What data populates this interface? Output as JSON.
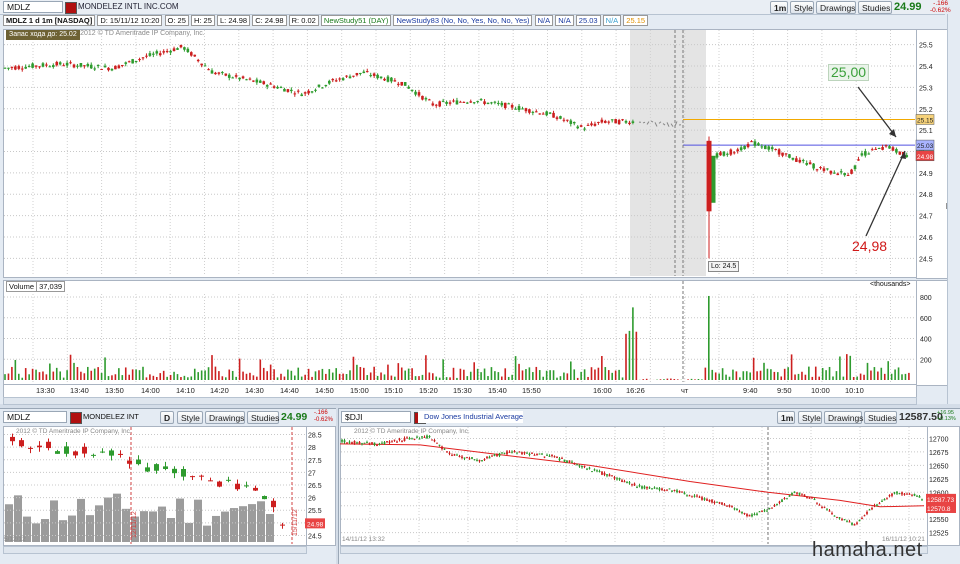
{
  "main": {
    "symbol": "MDLZ",
    "company": "MONDELEZ INTL INC.COM",
    "toolbar": {
      "style": "Style",
      "drawings": "Drawings",
      "studies": "Studies",
      "period": "1m"
    },
    "last_price": "24.99",
    "change": "-.166",
    "change_pct": "-0.62%",
    "info": [
      "MDLZ 1 d 1m [NASDAQ]",
      "D: 15/11/12 10:20",
      "O: 25",
      "H: 25",
      "L: 24.98",
      "C: 24.98",
      "R: 0.02",
      "NewStudy51 (DAY)",
      "NewStudy83 (No, No, Yes, No, No, Yes)",
      "N/A",
      "N/A",
      "25.03",
      "N/A",
      "25.15"
    ],
    "copyright": "© 2012 © TD Ameritrade IP Company, Inc.",
    "badge": "Запас хода до: 25.02",
    "low_label": "Lo: 24.5",
    "price_axis": [
      "25.5",
      "25.4",
      "25.3",
      "25.2",
      "25.1",
      "25",
      "24.9",
      "24.8",
      "24.7",
      "24.6",
      "24.5"
    ],
    "price_tags": {
      "orange": "25.15",
      "blue": "25.03",
      "red": "24.98"
    },
    "annotation_high": "25,00",
    "annotation_low": "24,98",
    "edge_label": "lK",
    "volume_label": "Volume",
    "volume_value": "37,039",
    "volume_units": "<thousands>",
    "volume_axis": [
      "800",
      "600",
      "400",
      "200"
    ],
    "time_axis": [
      "13:30",
      "13:40",
      "13:50",
      "14:00",
      "14:10",
      "14:20",
      "14:30",
      "14:40",
      "14:50",
      "15:00",
      "15:10",
      "15:20",
      "15:30",
      "15:40",
      "15:50",
      "16:00",
      "16:26",
      "чт",
      "9:40",
      "9:50",
      "10:00",
      "10:10"
    ],
    "colors": {
      "up": "#2e9b2e",
      "down": "#cc1f1f",
      "orange": "#f2a900",
      "blue": "#5050e0"
    }
  },
  "left": {
    "symbol": "MDLZ",
    "company": "MONDELEZ INT",
    "period": "D",
    "toolbar": {
      "style": "Style",
      "drawings": "Drawings",
      "studies": "Studies"
    },
    "last_price": "24.99",
    "change": "-.166",
    "change_pct": "-0.62%",
    "copyright": "2012 © TD Ameritrade IP Company, Inc.",
    "axis": [
      "28.5",
      "28",
      "27.5",
      "27",
      "26.5",
      "26",
      "25.5",
      "25",
      "24.5"
    ],
    "price_tag": "24.98",
    "date_label": "15/11/12",
    "date_label_left": "12/11/12",
    "bottom_label": "5/12/12"
  },
  "right": {
    "symbol": "$DJI",
    "company": "Dow Jones Industrial Average",
    "period": "1m",
    "toolbar": {
      "style": "Style",
      "drawings": "Drawings",
      "studies": "Studies"
    },
    "last_price": "12587.50",
    "change": "+16.95",
    "change_pct": "+0.13%",
    "copyright": "2012 © TD Ameritrade IP Company, Inc.",
    "axis": [
      "12700",
      "12675",
      "12650",
      "12625",
      "12600",
      "12575",
      "12550",
      "12525"
    ],
    "price_tags": [
      "12587.73",
      "12570.8"
    ],
    "bottom_left": "14/11/12 13:32",
    "bottom_right": "16/11/12 10:21"
  },
  "watermark": "hamaha.net"
}
